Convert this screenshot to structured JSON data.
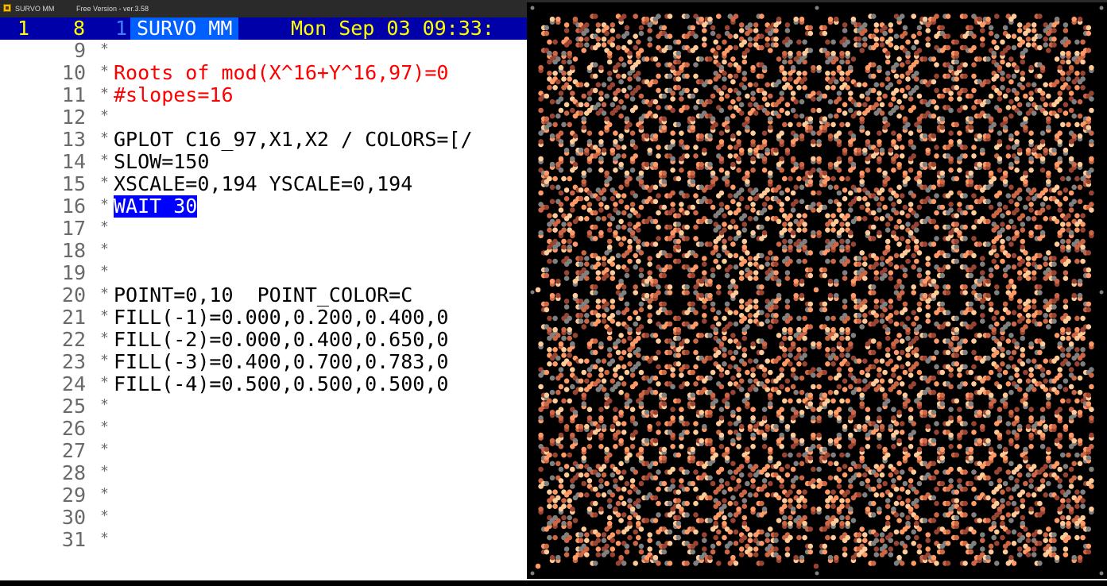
{
  "window": {
    "title": "SURVO MM",
    "version": "Free Version  -  ver.3.58"
  },
  "statusbar": {
    "field1": "1",
    "field2": "8",
    "field3": "1",
    "program": "SURVO MM",
    "datetime": "Mon Sep 03 09:33:"
  },
  "editor": {
    "lines": [
      {
        "num": "9",
        "text": ""
      },
      {
        "num": "10",
        "text": "Roots of mod(X^16+Y^16,97)=0",
        "style": "red"
      },
      {
        "num": "11",
        "text": "#slopes=16",
        "style": "red"
      },
      {
        "num": "12",
        "text": ""
      },
      {
        "num": "13",
        "text": "GPLOT C16_97,X1,X2 / COLORS=[/"
      },
      {
        "num": "14",
        "text": "SLOW=150"
      },
      {
        "num": "15",
        "text": "XSCALE=0,194 YSCALE=0,194"
      },
      {
        "num": "16",
        "text": "WAIT 30",
        "style": "sel"
      },
      {
        "num": "17",
        "text": ""
      },
      {
        "num": "18",
        "text": ""
      },
      {
        "num": "19",
        "text": ""
      },
      {
        "num": "20",
        "text": "POINT=0,10  POINT_COLOR=C"
      },
      {
        "num": "21",
        "text": "FILL(-1)=0.000,0.200,0.400,0"
      },
      {
        "num": "22",
        "text": "FILL(-2)=0.000,0.400,0.650,0"
      },
      {
        "num": "23",
        "text": "FILL(-3)=0.400,0.700,0.783,0"
      },
      {
        "num": "24",
        "text": "FILL(-4)=0.500,0.500,0.500,0"
      },
      {
        "num": "25",
        "text": ""
      },
      {
        "num": "26",
        "text": ""
      },
      {
        "num": "27",
        "text": ""
      },
      {
        "num": "28",
        "text": ""
      },
      {
        "num": "29",
        "text": ""
      },
      {
        "num": "30",
        "text": ""
      },
      {
        "num": "31",
        "text": ""
      }
    ],
    "marker": "*"
  },
  "plot": {
    "modulus": 97,
    "power": 16,
    "xscale": [
      0,
      194
    ],
    "yscale": [
      0,
      194
    ],
    "background": "#000000",
    "point_colors": [
      "#ff9966",
      "#ffcc99",
      "#cc6644",
      "#808080",
      "#994433"
    ],
    "corner_dot_color": "#808080"
  }
}
